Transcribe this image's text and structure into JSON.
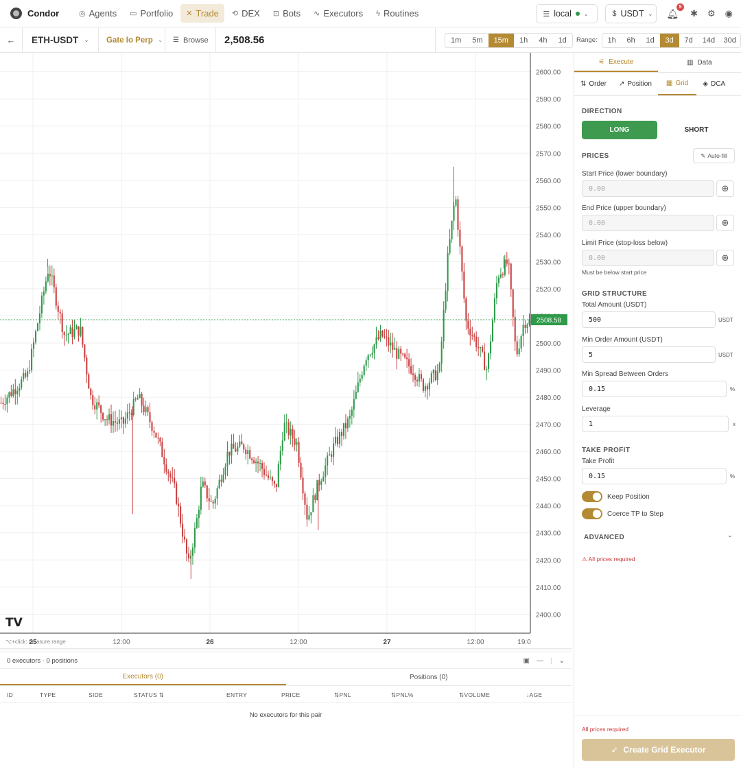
{
  "app": {
    "name": "Condor"
  },
  "nav": [
    {
      "label": "Agents",
      "icon": "brain-icon"
    },
    {
      "label": "Portfolio",
      "icon": "wallet-icon"
    },
    {
      "label": "Trade",
      "icon": "chart-icon",
      "active": true
    },
    {
      "label": "DEX",
      "icon": "swap-icon"
    },
    {
      "label": "Bots",
      "icon": "bot-icon"
    },
    {
      "label": "Executors",
      "icon": "activity-icon"
    },
    {
      "label": "Routines",
      "icon": "zap-icon"
    }
  ],
  "topright": {
    "server": "local",
    "currency": "USDT",
    "notifications": "5"
  },
  "subbar": {
    "pair": "ETH-USDT",
    "exchange": "Gate Io Perp",
    "browse": "Browse",
    "price": "2,508.56"
  },
  "timeframes": [
    "1m",
    "5m",
    "15m",
    "1h",
    "4h",
    "1d"
  ],
  "timeframe_active": "15m",
  "range_label": "Range:",
  "ranges": [
    "1h",
    "6h",
    "1d",
    "3d",
    "7d",
    "14d",
    "30d"
  ],
  "range_active": "3d",
  "chart_data": {
    "type": "candlestick",
    "symbol": "ETH-USDT",
    "interval": "15m",
    "ylim": [
      2393,
      2607
    ],
    "y_ticks": [
      "2600.00",
      "2590.00",
      "2580.00",
      "2570.00",
      "2560.00",
      "2550.00",
      "2540.00",
      "2530.00",
      "2520.00",
      "2510.00",
      "2500.00",
      "2490.00",
      "2480.00",
      "2470.00",
      "2460.00",
      "2450.00",
      "2440.00",
      "2430.00",
      "2420.00",
      "2410.00",
      "2400.00"
    ],
    "x_ticks": [
      "25",
      "12:00",
      "26",
      "12:00",
      "27",
      "12:00",
      "19:0"
    ],
    "last_price": "2508.58",
    "price_path": [
      [
        0,
        2478
      ],
      [
        0.05,
        2488
      ],
      [
        0.09,
        2528
      ],
      [
        0.12,
        2503
      ],
      [
        0.15,
        2505
      ],
      [
        0.17,
        2480
      ],
      [
        0.2,
        2472
      ],
      [
        0.23,
        2470
      ],
      [
        0.26,
        2480
      ],
      [
        0.29,
        2468
      ],
      [
        0.33,
        2445
      ],
      [
        0.355,
        2418
      ],
      [
        0.37,
        2434
      ],
      [
        0.38,
        2448
      ],
      [
        0.4,
        2440
      ],
      [
        0.43,
        2460
      ],
      [
        0.46,
        2462
      ],
      [
        0.49,
        2455
      ],
      [
        0.52,
        2446
      ],
      [
        0.535,
        2470
      ],
      [
        0.56,
        2463
      ],
      [
        0.58,
        2435
      ],
      [
        0.6,
        2448
      ],
      [
        0.63,
        2462
      ],
      [
        0.66,
        2472
      ],
      [
        0.69,
        2495
      ],
      [
        0.72,
        2503
      ],
      [
        0.75,
        2496
      ],
      [
        0.78,
        2490
      ],
      [
        0.8,
        2484
      ],
      [
        0.83,
        2490
      ],
      [
        0.845,
        2530
      ],
      [
        0.86,
        2555
      ],
      [
        0.88,
        2508
      ],
      [
        0.9,
        2500
      ],
      [
        0.92,
        2490
      ],
      [
        0.94,
        2525
      ],
      [
        0.96,
        2530
      ],
      [
        0.975,
        2495
      ],
      [
        0.99,
        2508
      ]
    ],
    "watermark": "TV"
  },
  "chart_hint": "⌥+click: measure range",
  "bottom": {
    "summary": "0 executors · 0 positions",
    "tabs": [
      "Executors (0)",
      "Positions (0)"
    ],
    "columns": [
      "ID",
      "TYPE",
      "SIDE",
      "STATUS ⇅",
      "ENTRY",
      "PRICE",
      "⇅PNL",
      "⇅PNL%",
      "⇅VOLUME",
      "↓AGE"
    ],
    "empty": "No executors for this pair"
  },
  "side": {
    "tabs": [
      {
        "label": "Execute",
        "icon": "sliders-icon"
      },
      {
        "label": "Data",
        "icon": "bar-chart-icon"
      }
    ],
    "subtabs": [
      {
        "label": "Order",
        "icon": "arrows-icon"
      },
      {
        "label": "Position",
        "icon": "trend-icon"
      },
      {
        "label": "Grid",
        "icon": "grid-icon"
      },
      {
        "label": "DCA",
        "icon": "layers-icon"
      }
    ],
    "direction_title": "DIRECTION",
    "long": "LONG",
    "short": "SHORT",
    "prices_title": "PRICES",
    "autofill": "Auto-fill",
    "start_label": "Start Price (lower boundary)",
    "start_ph": "0.00",
    "end_label": "End Price (upper boundary)",
    "end_ph": "0.00",
    "limit_label": "Limit Price (stop-loss below)",
    "limit_ph": "0.00",
    "limit_hint": "Must be below start price",
    "grid_title": "GRID STRUCTURE",
    "total_label": "Total Amount (USDT)",
    "total_value": "500",
    "total_unit": "USDT",
    "minorder_label": "Min Order Amount (USDT)",
    "minorder_value": "5",
    "minorder_unit": "USDT",
    "spread_label": "Min Spread Between Orders",
    "spread_value": "0.15",
    "spread_unit": "%",
    "leverage_label": "Leverage",
    "leverage_value": "1",
    "leverage_unit": "x",
    "tp_title": "TAKE PROFIT",
    "tp_label": "Take Profit",
    "tp_value": "0.15",
    "tp_unit": "%",
    "keep_position": "Keep Position",
    "coerce_tp": "Coerce TP to Step",
    "advanced": "ADVANCED",
    "error": "All prices required",
    "footer_error": "All prices required",
    "create": "Create Grid Executor"
  },
  "colors": {
    "accent": "#b48a33",
    "long": "#3d9a4f",
    "up_candle": "#2e9a4a",
    "down_candle": "#c94040",
    "price_line": "#2e9a4a"
  }
}
